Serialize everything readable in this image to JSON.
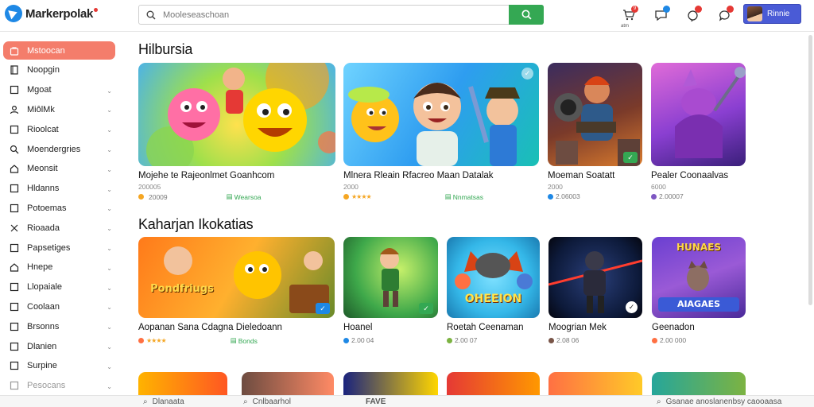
{
  "app": {
    "name": "Markerpolak"
  },
  "search": {
    "placeholder": "Mooleseaschoan"
  },
  "header_icons": [
    {
      "name": "cart-icon",
      "badge": "9",
      "sub": "atm"
    },
    {
      "name": "chat-icon",
      "badge": "",
      "sub": ""
    },
    {
      "name": "notification-icon",
      "badge": "",
      "sub": ""
    },
    {
      "name": "message-icon",
      "badge": "",
      "sub": ""
    }
  ],
  "user": {
    "label": "Rinnie"
  },
  "sidebar": {
    "items": [
      {
        "label": "Mstoocan",
        "icon": "bag-icon",
        "active": true,
        "chevron": false
      },
      {
        "label": "Noopgin",
        "icon": "book-icon",
        "active": false,
        "chevron": false
      },
      {
        "label": "Mgoat",
        "icon": "box-icon",
        "active": false,
        "chevron": true
      },
      {
        "label": "MiôlMk",
        "icon": "person-icon",
        "active": false,
        "chevron": true
      },
      {
        "label": "Rioolcat",
        "icon": "box-icon",
        "active": false,
        "chevron": true
      },
      {
        "label": "Moendergries",
        "icon": "search-icon",
        "active": false,
        "chevron": true
      },
      {
        "label": "Meonsit",
        "icon": "home-icon",
        "active": false,
        "chevron": true
      },
      {
        "label": "Hldanns",
        "icon": "box-icon",
        "active": false,
        "chevron": true
      },
      {
        "label": "Potoemas",
        "icon": "box-icon",
        "active": false,
        "chevron": true
      },
      {
        "label": "Rioaada",
        "icon": "tools-icon",
        "active": false,
        "chevron": true
      },
      {
        "label": "Papsetiges",
        "icon": "box-icon",
        "active": false,
        "chevron": true
      },
      {
        "label": "Hnepe",
        "icon": "home-icon",
        "active": false,
        "chevron": true
      },
      {
        "label": "Llopaiale",
        "icon": "box-icon",
        "active": false,
        "chevron": true
      },
      {
        "label": "Coolaan",
        "icon": "box-icon",
        "active": false,
        "chevron": true
      },
      {
        "label": "Brsonns",
        "icon": "box-icon",
        "active": false,
        "chevron": true
      },
      {
        "label": "Dlanien",
        "icon": "box-icon",
        "active": false,
        "chevron": true
      },
      {
        "label": "Surpine",
        "icon": "box-icon",
        "active": false,
        "chevron": true
      },
      {
        "label": "Pesocans",
        "icon": "box-icon",
        "active": false,
        "chevron": true
      }
    ]
  },
  "sections": [
    {
      "title": "Hilbursia",
      "cards": [
        {
          "title": "Mojehe te Rajeonlmet Goanhcom",
          "sub": "200005",
          "meta": "20009",
          "tag": "Wearsoa"
        },
        {
          "title": "Mlnera Rleain Rfacreo  Maan Datalak",
          "sub": "2000",
          "meta": "",
          "tag": "Nnmatsas"
        },
        {
          "title": "Moeman Soatatt",
          "sub": "2000",
          "meta": "2.06003",
          "tag": ""
        },
        {
          "title": "Pealer Coonaalvas",
          "sub": "6000",
          "meta": "2.00007",
          "tag": ""
        }
      ]
    },
    {
      "title": "Kaharjan  Ikokatias",
      "cards": [
        {
          "title": "Aopanan Sana Cdagna  Dieledoann",
          "sub": "",
          "meta": "",
          "tag": "Bonds",
          "label": "Pondfriugs"
        },
        {
          "title": "Hoanel",
          "sub": "",
          "meta": "2.00 04",
          "tag": ""
        },
        {
          "title": "Roetah Ceenaman",
          "sub": "",
          "meta": "2.00 07",
          "tag": "",
          "label": "OHEEION"
        },
        {
          "title": "Moogrian Mek",
          "sub": "",
          "meta": "2.08 06",
          "tag": ""
        },
        {
          "title": "Geenadon",
          "sub": "",
          "meta": "2.00 000",
          "tag": "",
          "label": "HUNAES",
          "label2": "AIAGAES"
        }
      ]
    }
  ],
  "bottom_row": [
    {
      "label": "Dlanaata"
    },
    {
      "label": "Cnlbaarhol"
    },
    {
      "label": "FAVE"
    },
    {
      "label": "Gsanae anoslanenbsy caooaasa"
    }
  ],
  "colors": {
    "accent": "#f47d6b",
    "search_button": "#34a853",
    "user_button": "#4a5bd6"
  }
}
